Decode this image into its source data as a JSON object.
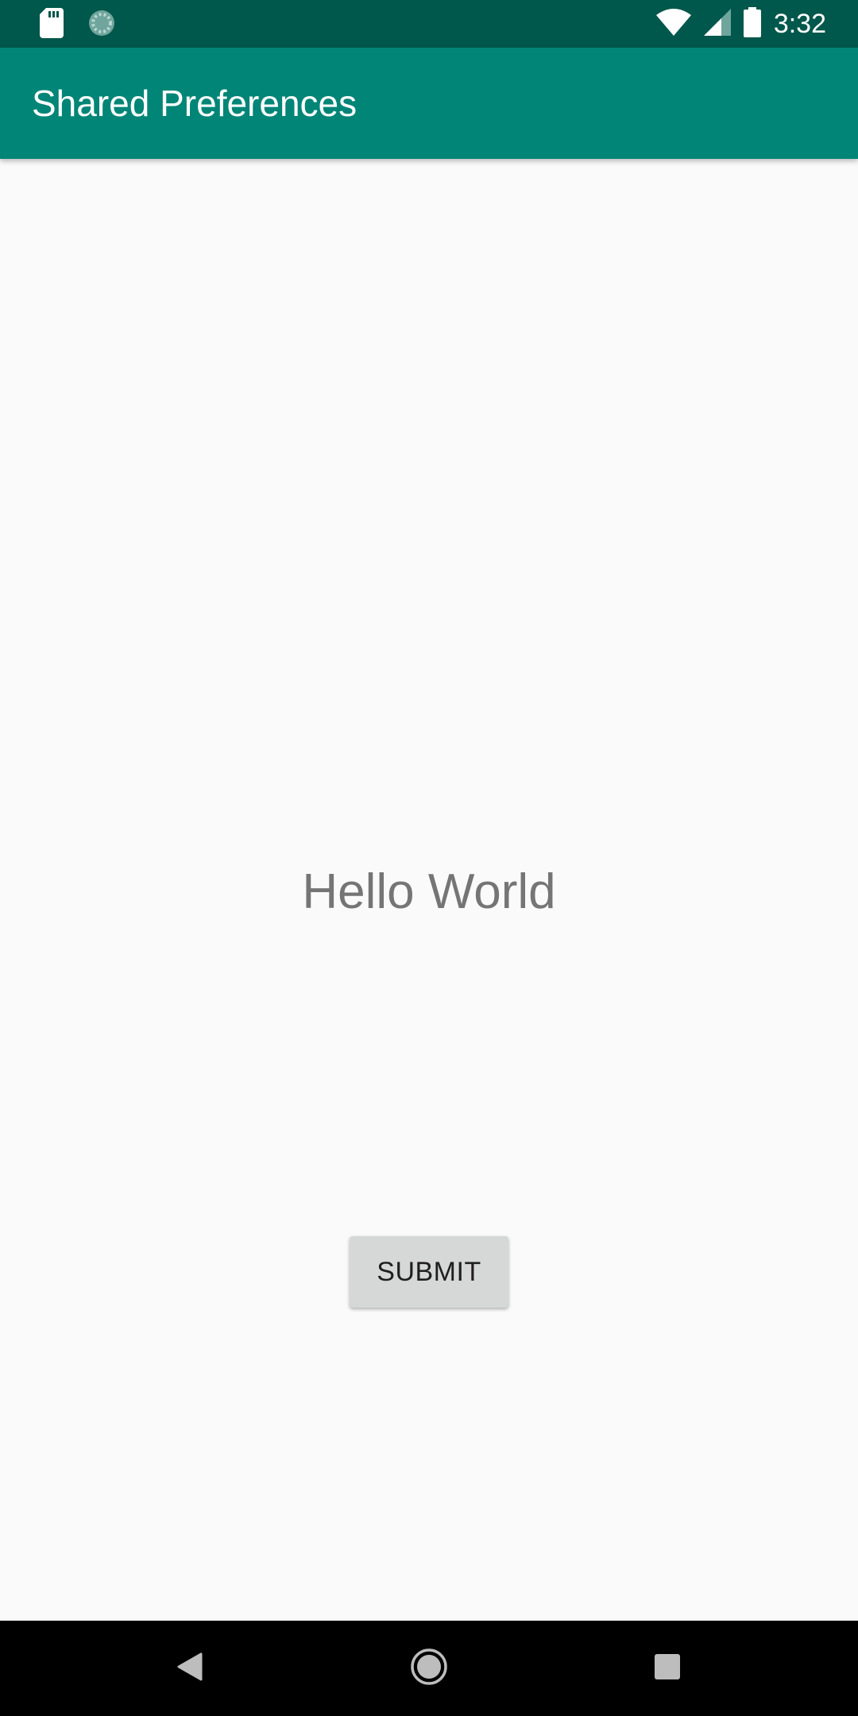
{
  "status_bar": {
    "time": "3:32",
    "icons": [
      "sd-card-icon",
      "loading-icon",
      "wifi-icon",
      "signal-icon",
      "battery-icon"
    ]
  },
  "app_bar": {
    "title": "Shared Preferences"
  },
  "main": {
    "text": "Hello World",
    "submit_label": "SUBMIT"
  },
  "nav_bar": {
    "icons": [
      "back-icon",
      "home-icon",
      "recents-icon"
    ]
  },
  "colors": {
    "status_bar": "#00574b",
    "app_bar": "#008577",
    "background": "#fafafa",
    "button": "#d6d7d7",
    "text_secondary": "#757575"
  }
}
